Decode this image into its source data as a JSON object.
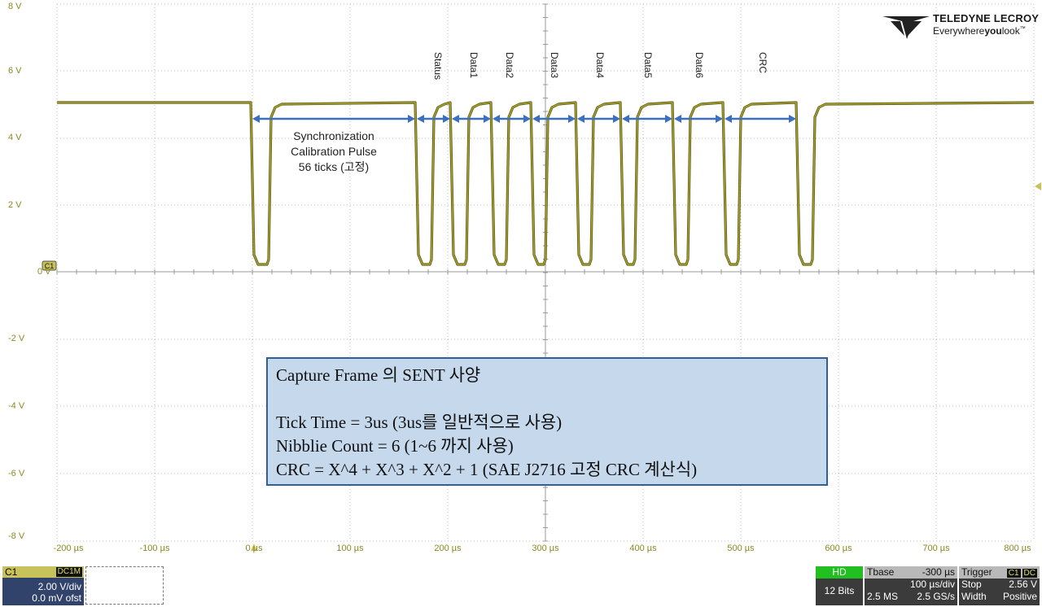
{
  "brand": {
    "name": "TELEDYNE LECROY",
    "tagline_a": "Everywhere",
    "tagline_b": "you",
    "tagline_c": "look",
    "tm": "™"
  },
  "y_axis": {
    "labels": [
      "8 V",
      "6 V",
      "4 V",
      "2 V",
      "0 V",
      "-2 V",
      "-4 V",
      "-6 V",
      "-8 V"
    ]
  },
  "x_axis": {
    "labels": [
      "-200 µs",
      "-100 µs",
      "0 µs",
      "100 µs",
      "200 µs",
      "300 µs",
      "400 µs",
      "500 µs",
      "600 µs",
      "700 µs",
      "800 µs"
    ]
  },
  "channel_marker": "C1",
  "segments": [
    "Status",
    "Data1",
    "Data2",
    "Data3",
    "Data4",
    "Data5",
    "Data6",
    "CRC"
  ],
  "sync_annotation": {
    "line1": "Synchronization",
    "line2": "Calibration  Pulse",
    "line3": "56 ticks (고정)"
  },
  "info_box": {
    "title": "Capture Frame 의 SENT 사양",
    "line1": "Tick Time = 3us (3us를 일반적으로 사용)",
    "line2": "Nibblie Count = 6 (1~6 까지 사용)",
    "line3": "CRC = X^4 +  X^3 +  X^2 +  1 (SAE J2716 고정 CRC 계산식)"
  },
  "channel_panel": {
    "name": "C1",
    "coupling": "DC1M",
    "vdiv": "2.00 V/div",
    "offset": "0.0 mV ofst"
  },
  "acq_panel": {
    "mode": "HD",
    "bits": "12 Bits"
  },
  "timebase_panel": {
    "title": "Tbase",
    "delay": "-300 µs",
    "tdiv": "100 µs/div",
    "samples": "2.5 MS",
    "rate": "2.5 GS/s"
  },
  "trigger_panel": {
    "title": "Trigger",
    "src_badge": "C1",
    "cpl_badge": "DC",
    "mode": "Stop",
    "level": "2.56 V",
    "type": "Width",
    "slope": "Positive"
  },
  "colors": {
    "trace": "#a9a32a",
    "grid": "#bdbdbd",
    "arrow": "#3a6fc2",
    "info_fill": "#c5d8ec",
    "info_border": "#2f5f9c"
  }
}
